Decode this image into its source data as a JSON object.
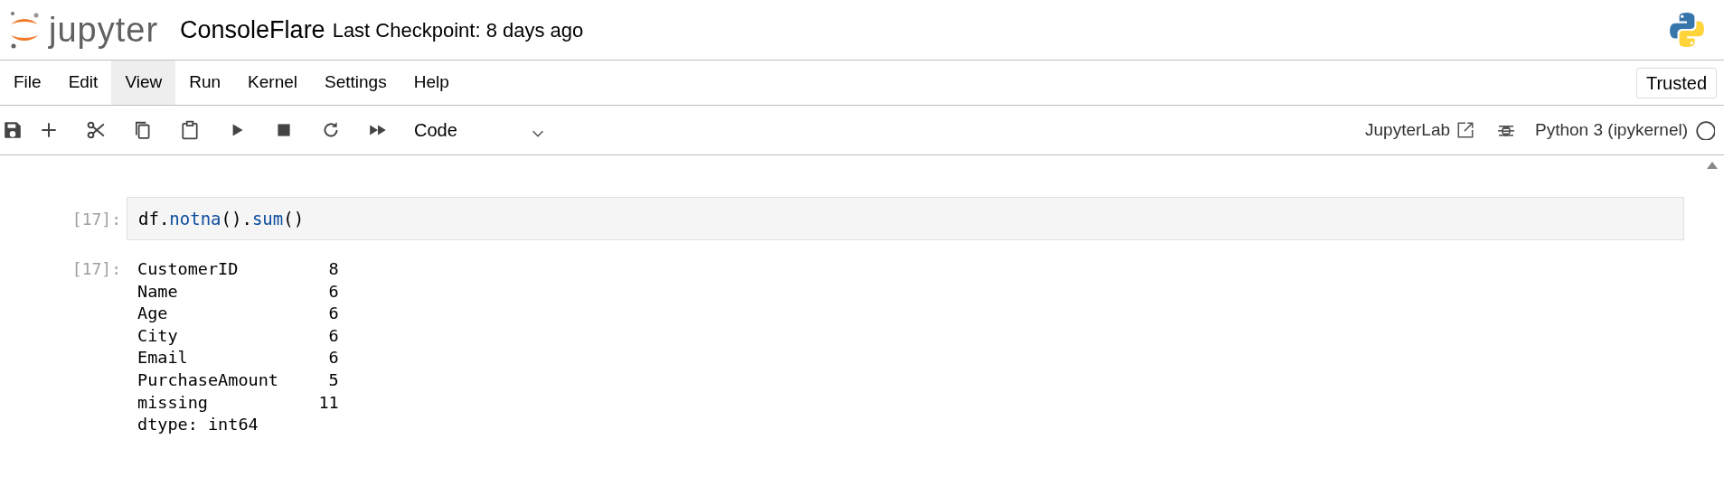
{
  "header": {
    "logo_text": "jupyter",
    "notebook_title": "ConsoleFlare",
    "checkpoint": "Last Checkpoint: 8 days ago"
  },
  "menu": [
    {
      "label": "File",
      "selected": false
    },
    {
      "label": "Edit",
      "selected": false
    },
    {
      "label": "View",
      "selected": true
    },
    {
      "label": "Run",
      "selected": false
    },
    {
      "label": "Kernel",
      "selected": false
    },
    {
      "label": "Settings",
      "selected": false
    },
    {
      "label": "Help",
      "selected": false
    }
  ],
  "trusted": "Trusted",
  "toolbar": {
    "tools": [
      {
        "kind": "save"
      },
      {
        "kind": "add"
      },
      {
        "kind": "cut"
      },
      {
        "kind": "copy"
      },
      {
        "kind": "paste"
      },
      {
        "kind": "run"
      },
      {
        "kind": "stop"
      },
      {
        "kind": "restart"
      },
      {
        "kind": "run-all"
      }
    ],
    "cell_type": "Code",
    "open_lab": "JupyterLab",
    "kernel": "Python 3 (ipykernel)",
    "kernel_busy": false
  },
  "cell": {
    "input_prompt": "[17]:",
    "code": [
      {
        "text": "df",
        "kind": "name"
      },
      {
        "text": ".",
        "kind": "op"
      },
      {
        "text": "notna",
        "kind": "attr"
      },
      {
        "text": "()",
        "kind": "op"
      },
      {
        "text": ".",
        "kind": "op"
      },
      {
        "text": "sum",
        "kind": "attr"
      },
      {
        "text": "()",
        "kind": "op"
      }
    ],
    "output_prompt": "[17]:",
    "output": "CustomerID         8\nName               6\nAge                6\nCity               6\nEmail              6\nPurchaseAmount     5\nmissing           11\ndtype: int64"
  }
}
